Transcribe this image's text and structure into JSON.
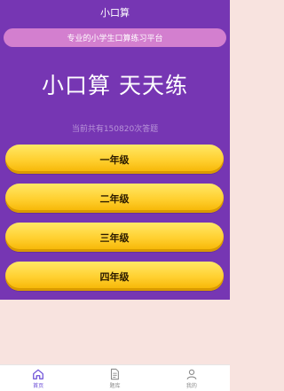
{
  "header": {
    "title": "小口算"
  },
  "slogan": "专业的小学生口算练习平台",
  "headline": "小口算 天天练",
  "stats": {
    "text": "当前共有150820次答题"
  },
  "grades": [
    {
      "label": "一年级"
    },
    {
      "label": "二年级"
    },
    {
      "label": "三年级"
    },
    {
      "label": "四年级"
    }
  ],
  "tabs": [
    {
      "label": "首页",
      "icon": "home-icon",
      "active": true
    },
    {
      "label": "题库",
      "icon": "document-icon",
      "active": false
    },
    {
      "label": "我的",
      "icon": "user-icon",
      "active": false
    }
  ],
  "colors": {
    "primary": "#7636b3",
    "accent": "#d37fcf",
    "button": "#ffcf2e",
    "tab_active": "#6a4bd6"
  }
}
